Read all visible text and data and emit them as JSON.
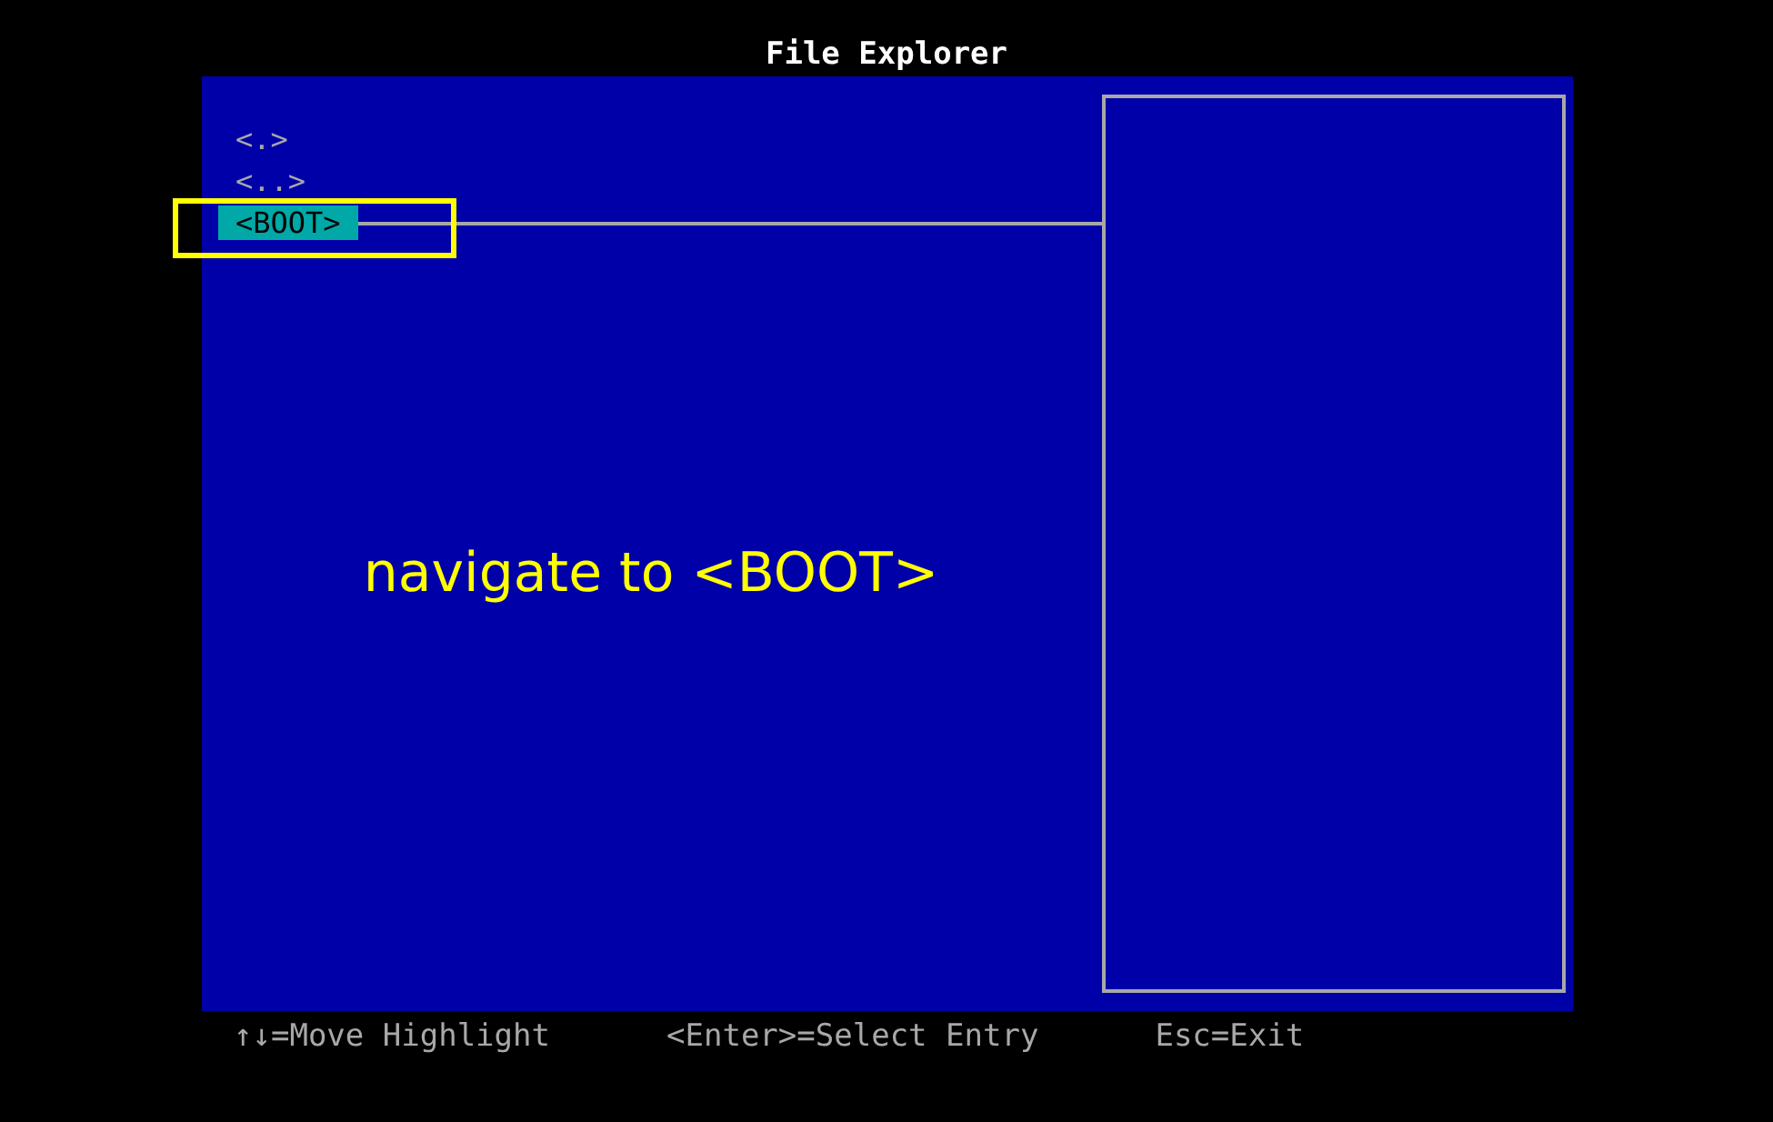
{
  "window": {
    "title": "File Explorer"
  },
  "entries": [
    {
      "label": "<.>",
      "selected": false
    },
    {
      "label": "<..>",
      "selected": false
    },
    {
      "label": "<BOOT>",
      "selected": true
    }
  ],
  "annotation": {
    "text": "navigate to <BOOT>",
    "highlight": true
  },
  "help_bar": [
    "↑↓=Move Highlight",
    "<Enter>=Select Entry",
    "Esc=Exit"
  ]
}
